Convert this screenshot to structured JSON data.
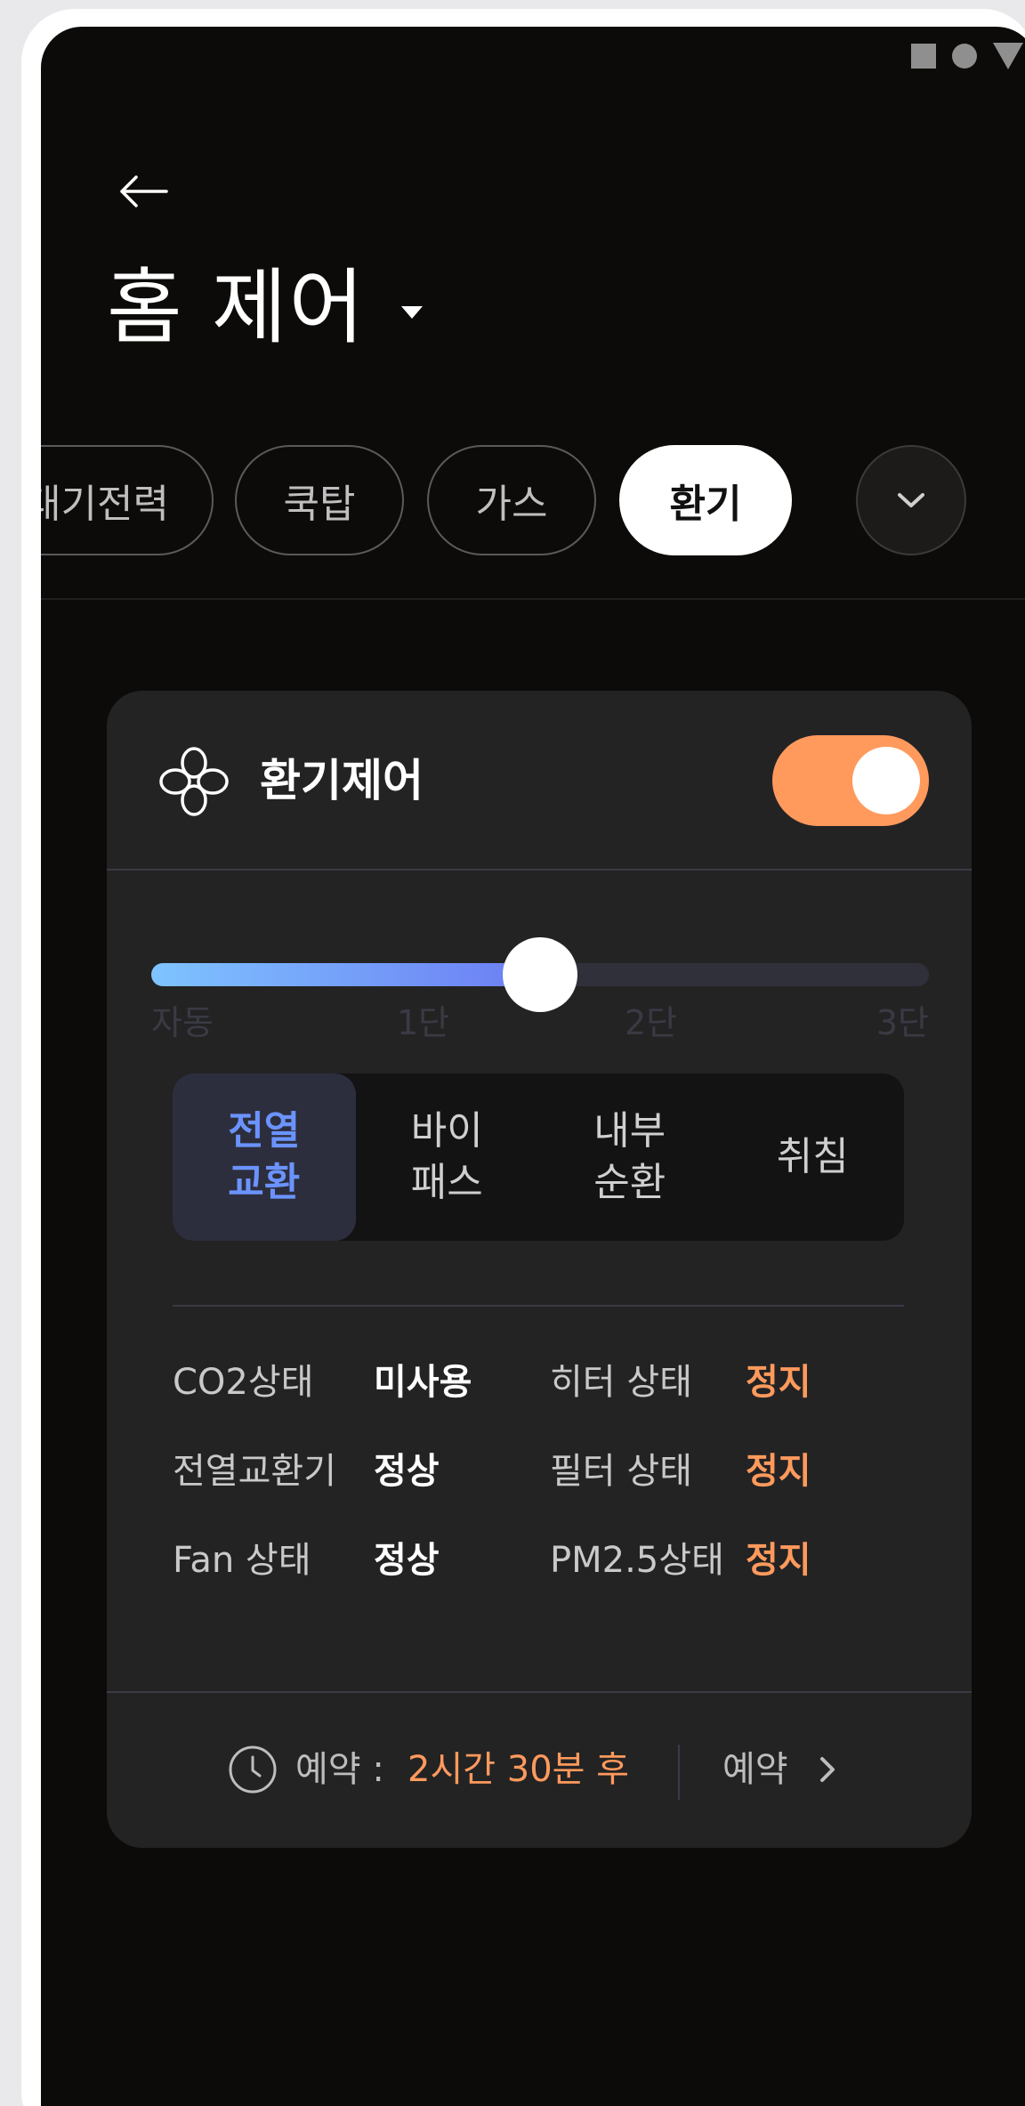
{
  "header": {
    "title": "홈 제어"
  },
  "tabs": [
    {
      "label": "대기전력",
      "active": false
    },
    {
      "label": "쿡탑",
      "active": false
    },
    {
      "label": "가스",
      "active": false
    },
    {
      "label": "환기",
      "active": true
    }
  ],
  "card": {
    "title": "환기제어",
    "toggle_on": true,
    "accent_color": "#ff9a5c",
    "slider": {
      "labels": [
        "자동",
        "1단",
        "2단",
        "3단"
      ],
      "value_fraction": 0.5
    },
    "modes": [
      {
        "line1": "전열",
        "line2": "교환",
        "active": true
      },
      {
        "line1": "바이",
        "line2": "패스",
        "active": false
      },
      {
        "line1": "내부",
        "line2": "순환",
        "active": false
      },
      {
        "line1": "취침",
        "line2": "",
        "active": false
      }
    ],
    "status": [
      {
        "label_left": "CO2상태",
        "value_left": "미사용",
        "label_right": "히터 상태",
        "value_right": "정지"
      },
      {
        "label_left": "전열교환기",
        "value_left": "정상",
        "label_right": "필터 상태",
        "value_right": "정지"
      },
      {
        "label_left": "Fan 상태",
        "value_left": "정상",
        "label_right": "PM2.5상태",
        "value_right": "정지"
      }
    ],
    "reservation": {
      "label": "예약 :",
      "time": "2시간 30분 후",
      "link": "예약"
    }
  }
}
